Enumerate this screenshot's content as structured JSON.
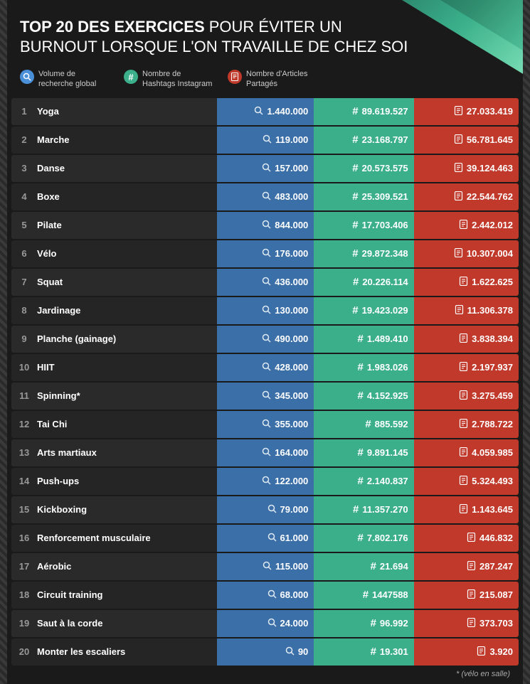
{
  "header": {
    "title_bold": "TOP 20 DES EXERCICES",
    "title_normal": " POUR ÉVITER UN BURNOUT LORSQUE L'ON TRAVAILLE DE CHEZ SOI"
  },
  "legend": [
    {
      "icon": "🔍",
      "type": "blue",
      "symbol": "search",
      "label": "Volume de recherche global"
    },
    {
      "icon": "#",
      "type": "green",
      "symbol": "hash",
      "label": "Nombre de Hashtags Instagram"
    },
    {
      "icon": "📋",
      "type": "red",
      "symbol": "doc",
      "label": "Nombre d'Articles Partagés"
    }
  ],
  "columns": {
    "search_label": "Volume de recherche global",
    "hashtag_label": "Nombre de Hashtags Instagram",
    "articles_label": "Nombre d'Articles Partagés"
  },
  "rows": [
    {
      "rank": 1,
      "name": "Yoga",
      "search": "1.440.000",
      "hashtag": "89.619.527",
      "articles": "27.033.419"
    },
    {
      "rank": 2,
      "name": "Marche",
      "search": "119.000",
      "hashtag": "23.168.797",
      "articles": "56.781.645"
    },
    {
      "rank": 3,
      "name": "Danse",
      "search": "157.000",
      "hashtag": "20.573.575",
      "articles": "39.124.463"
    },
    {
      "rank": 4,
      "name": "Boxe",
      "search": "483.000",
      "hashtag": "25.309.521",
      "articles": "22.544.762"
    },
    {
      "rank": 5,
      "name": "Pilate",
      "search": "844.000",
      "hashtag": "17.703.406",
      "articles": "2.442.012"
    },
    {
      "rank": 6,
      "name": "Vélo",
      "search": "176.000",
      "hashtag": "29.872.348",
      "articles": "10.307.004"
    },
    {
      "rank": 7,
      "name": "Squat",
      "search": "436.000",
      "hashtag": "20.226.114",
      "articles": "1.622.625"
    },
    {
      "rank": 8,
      "name": "Jardinage",
      "search": "130.000",
      "hashtag": "19.423.029",
      "articles": "11.306.378"
    },
    {
      "rank": 9,
      "name": "Planche (gainage)",
      "search": "490.000",
      "hashtag": "1.489.410",
      "articles": "3.838.394"
    },
    {
      "rank": 10,
      "name": "HIIT",
      "search": "428.000",
      "hashtag": "1.983.026",
      "articles": "2.197.937"
    },
    {
      "rank": 11,
      "name": "Spinning*",
      "search": "345.000",
      "hashtag": "4.152.925",
      "articles": "3.275.459"
    },
    {
      "rank": 12,
      "name": "Tai Chi",
      "search": "355.000",
      "hashtag": "885.592",
      "articles": "2.788.722"
    },
    {
      "rank": 13,
      "name": "Arts martiaux",
      "search": "164.000",
      "hashtag": "9.891.145",
      "articles": "4.059.985"
    },
    {
      "rank": 14,
      "name": "Push-ups",
      "search": "122.000",
      "hashtag": "2.140.837",
      "articles": "5.324.493"
    },
    {
      "rank": 15,
      "name": "Kickboxing",
      "search": "79.000",
      "hashtag": "11.357.270",
      "articles": "1.143.645"
    },
    {
      "rank": 16,
      "name": "Renforcement musculaire",
      "search": "61.000",
      "hashtag": "7.802.176",
      "articles": "446.832"
    },
    {
      "rank": 17,
      "name": "Aérobic",
      "search": "115.000",
      "hashtag": "21.694",
      "articles": "287.247"
    },
    {
      "rank": 18,
      "name": "Circuit training",
      "search": "68.000",
      "hashtag": "1447588",
      "articles": "215.087"
    },
    {
      "rank": 19,
      "name": "Saut à la corde",
      "search": "24.000",
      "hashtag": "96.992",
      "articles": "373.703"
    },
    {
      "rank": 20,
      "name": "Monter les escaliers",
      "search": "90",
      "hashtag": "19.301",
      "articles": "3.920"
    }
  ],
  "footnote": "* (vélo en salle)"
}
